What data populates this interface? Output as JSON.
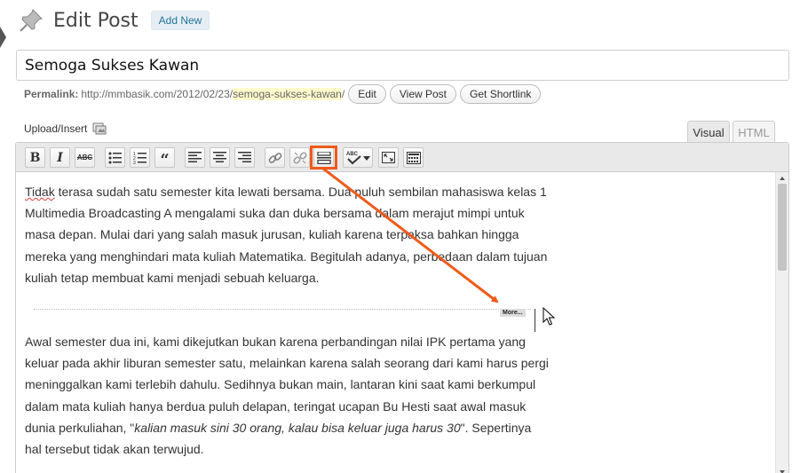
{
  "header": {
    "page_title": "Edit Post",
    "add_new_label": "Add New"
  },
  "post": {
    "title_value": "Semoga Sukses Kawan"
  },
  "permalink": {
    "label": "Permalink:",
    "base_url": "http://mmbasik.com/2012/02/23/",
    "slug": "semoga-sukses-kawan",
    "trailing": "/",
    "edit_label": "Edit",
    "view_post_label": "View Post",
    "get_shortlink_label": "Get Shortlink"
  },
  "upload": {
    "label": "Upload/Insert",
    "icon": "media-icon"
  },
  "tabs": {
    "visual": "Visual",
    "html": "HTML"
  },
  "toolbar": {
    "buttons": [
      {
        "name": "bold",
        "glyph": "B"
      },
      {
        "name": "italic",
        "glyph": "I"
      },
      {
        "name": "strikethrough",
        "glyph": "ABC"
      },
      {
        "name": "unordered-list"
      },
      {
        "name": "ordered-list"
      },
      {
        "name": "blockquote",
        "glyph": "“"
      },
      {
        "name": "align-left"
      },
      {
        "name": "align-center"
      },
      {
        "name": "align-right"
      },
      {
        "name": "insert-link"
      },
      {
        "name": "unlink"
      },
      {
        "name": "insert-more-tag"
      },
      {
        "name": "spellcheck",
        "glyph": "ABC"
      },
      {
        "name": "fullscreen"
      },
      {
        "name": "kitchen-sink"
      }
    ],
    "highlight_color": "#f05a1a"
  },
  "content": {
    "paragraph1_word1": "Tidak",
    "paragraph1_rest": " terasa sudah satu semester kita lewati bersama. Dua puluh sembilan mahasiswa kelas 1 Multimedia Broadcasting A mengalami suka dan duka bersama dalam merajut mimpi untuk masa depan. Mulai dari yang salah masuk jurusan, kuliah karena terpaksa bahkan hingga mereka yang menghindari mata kuliah Matematika. Begitulah adanya, perbedaan dalam tujuan kuliah tetap membuat kami menjadi sebuah keluarga.",
    "more_tag": "More...",
    "paragraph2_part1": "Awal semester dua ini, kami dikejutkan bukan karena perbandingan nilai IPK pertama yang keluar pada akhir liburan semester satu, melainkan karena salah seorang dari kami harus pergi meninggalkan kami terlebih dahulu. Sedihnya bukan main, lantaran kini saat kami berkumpul dalam mata kuliah hanya berdua puluh delapan, teringat ucapan Bu Hesti saat awal masuk dunia perkuliahan, \"",
    "paragraph2_italic": "kalian masuk sini 30 orang, kalau bisa keluar juga harus 30",
    "paragraph2_part2": "\". Sepertinya hal tersebut tidak akan terwujud."
  },
  "colors": {
    "accent_link": "#21759b",
    "annotation": "#f05a1a",
    "slug_highlight": "#fffbcc"
  }
}
